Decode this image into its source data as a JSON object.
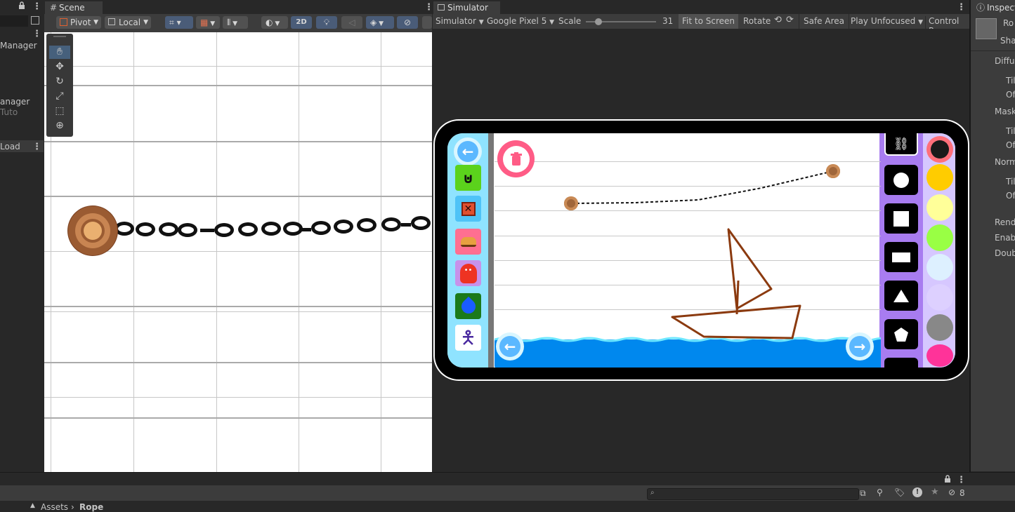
{
  "left_panel": {
    "items": [
      "Manager",
      "anager",
      "Tuto",
      "Load"
    ],
    "lock_icon": "lock-icon",
    "kebab_label": "⋮"
  },
  "scene": {
    "tab_label": "Scene",
    "pivot_label": "Pivot",
    "local_label": "Local",
    "mode_2d_label": "2D",
    "tools": [
      "hand-tool",
      "move-tool",
      "rotate-tool",
      "scale-tool",
      "rect-tool",
      "transform-tool"
    ]
  },
  "simulator": {
    "tab_label": "Simulator",
    "view_label": "Simulator",
    "device_label": "Google Pixel 5",
    "scale_label": "Scale",
    "scale_value": "31",
    "scale_fraction": 0.18,
    "fit_label": "Fit to Screen",
    "rotate_label": "Rotate",
    "safe_area_label": "Safe Area",
    "play_label": "Play Unfocused",
    "control_label": "Control Pa",
    "game": {
      "left_buttons": [
        "back-arrow-icon",
        "magnet-icon",
        "crate-icon",
        "burger-icon",
        "monster-icon",
        "water-drop-icon",
        "person-icon"
      ],
      "left_button_colors": [
        "#7ee7ff",
        "#5bd21c",
        "#4fc3f7",
        "#ff6f91",
        "#c792ea",
        "#1b7a1b",
        "#ffffff"
      ],
      "shapes": [
        "chain-shape-icon",
        "circle-shape-icon",
        "square-shape-icon",
        "rect-shape-icon",
        "triangle-shape-icon",
        "pentagon-shape-icon"
      ],
      "swatches": [
        "#1a1a1a",
        "#ffcc00",
        "#ffff99",
        "#99ff44",
        "#ddf0ff",
        "#ddd0ff",
        "#888888",
        "#ff3399"
      ],
      "water_color": "#0088ee",
      "drawing_color": "#8b3a0f"
    }
  },
  "inspector": {
    "tab_label": "Inspect",
    "header": [
      "Ro",
      "Sha"
    ],
    "rows": [
      "Diffus",
      "Til",
      "Of",
      "Mask",
      "Til",
      "Of",
      "Norm",
      "Til",
      "Of",
      "Rend",
      "Enab",
      "Doub"
    ]
  },
  "bottom": {
    "breadcrumb_root": "Assets",
    "breadcrumb_current": "Rope",
    "hidden_count": "8"
  }
}
